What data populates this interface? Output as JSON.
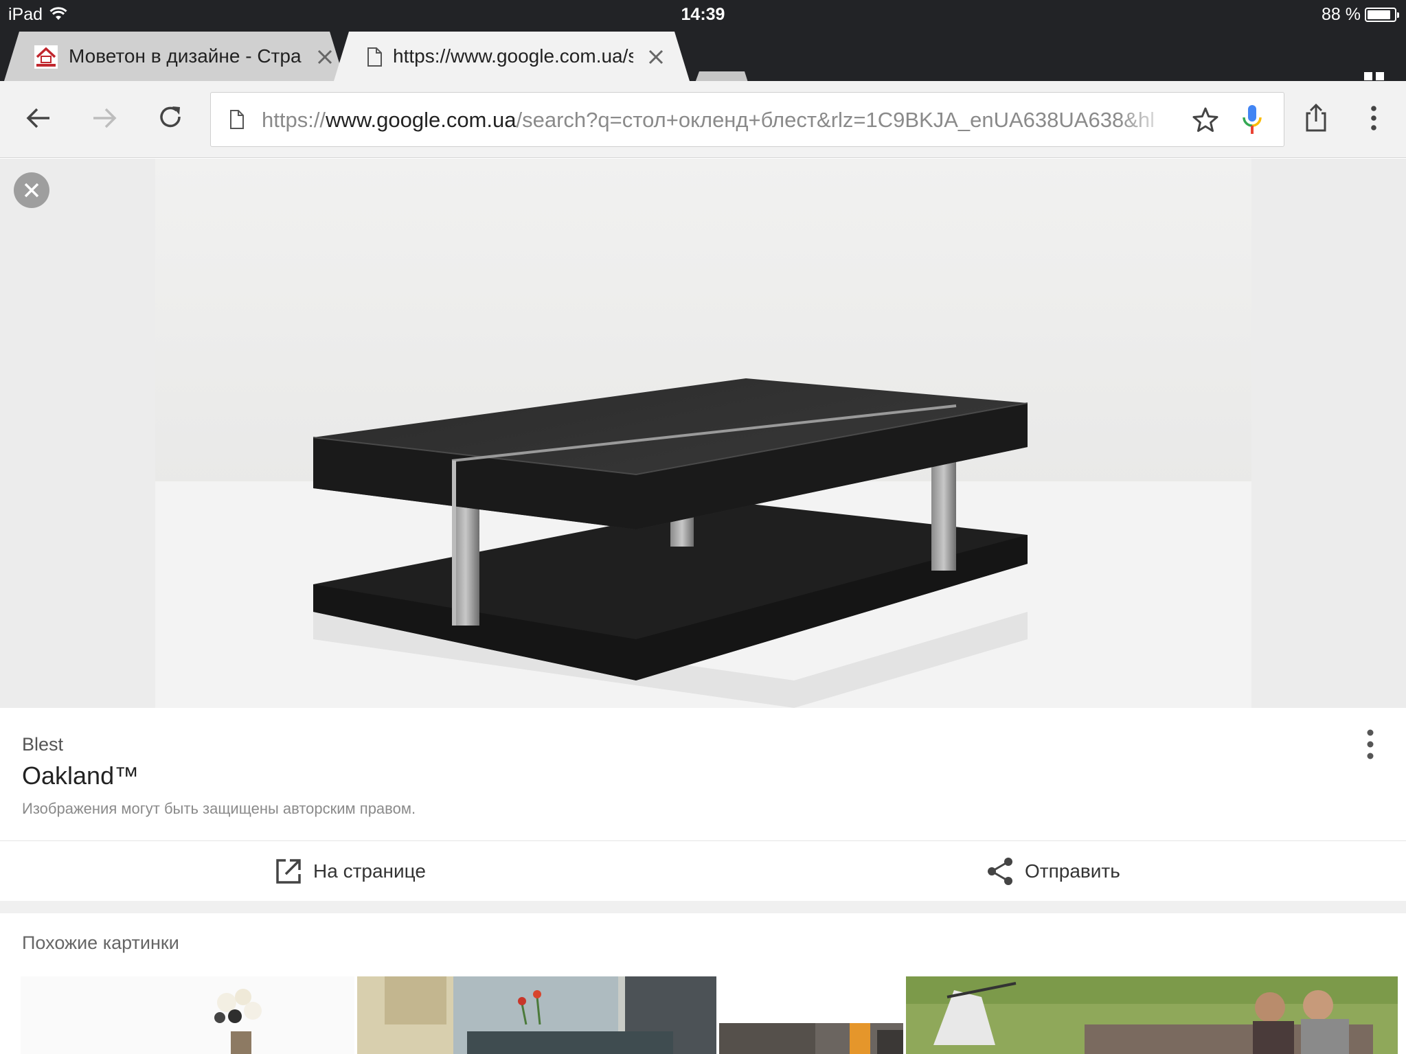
{
  "status_bar": {
    "carrier": "iPad",
    "time": "14:39",
    "battery": "88 %",
    "battery_level": 0.88
  },
  "tabs": [
    {
      "title": "Моветон в дизайне - Страница",
      "active": false,
      "favicon": "house-logo-icon"
    },
    {
      "title": "https://www.google.com.ua/search",
      "active": true,
      "favicon": "page-icon"
    }
  ],
  "toolbar": {
    "url_scheme": "https://",
    "url_host": "www.google.com.ua",
    "url_path": "/search?q=стол+окленд+блест&rlz=1C9BKJA_enUA638UA638&hl"
  },
  "image_result": {
    "source": "Blest",
    "title": "Oakland™",
    "copyright": "Изображения могут быть защищены авторским правом.",
    "actions": {
      "open": "На странице",
      "share": "Отправить"
    }
  },
  "similar": {
    "heading": "Похожие картинки"
  },
  "colors": {
    "chrome_dark": "#222326",
    "toolbar_bg": "#f2f2f2",
    "mic_blue": "#4285f4",
    "mic_red": "#ea4335",
    "mic_yellow": "#fbbc05",
    "mic_green": "#34a853"
  }
}
